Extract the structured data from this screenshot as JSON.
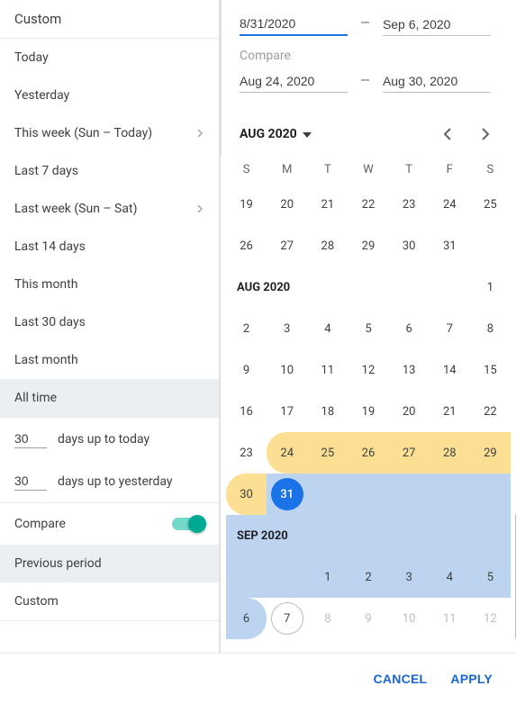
{
  "presets": {
    "custom": "Custom",
    "today": "Today",
    "yesterday": "Yesterday",
    "this_week": "This week (Sun – Today)",
    "last7": "Last 7 days",
    "last_week": "Last week (Sun – Sat)",
    "last14": "Last 14 days",
    "this_month": "This month",
    "last30": "Last 30 days",
    "last_month": "Last month",
    "all_time": "All time"
  },
  "days_up": {
    "today_value": "30",
    "today_label": "days up to today",
    "yesterday_value": "30",
    "yesterday_label": "days up to yesterday"
  },
  "compare_section": {
    "label": "Compare",
    "previous": "Previous period",
    "custom": "Custom"
  },
  "range": {
    "start": "8/31/2020",
    "dash": "—",
    "end": "Sep 6, 2020"
  },
  "compare_range": {
    "label": "Compare",
    "start": "Aug 24, 2020",
    "dash": "—",
    "end": "Aug 30, 2020"
  },
  "month_nav": {
    "label": "AUG 2020"
  },
  "dow": [
    "S",
    "M",
    "T",
    "W",
    "T",
    "F",
    "S"
  ],
  "cal": {
    "prev_rows": [
      [
        "19",
        "20",
        "21",
        "22",
        "23",
        "24",
        "25"
      ],
      [
        "26",
        "27",
        "28",
        "29",
        "30",
        "31",
        ""
      ]
    ],
    "aug_header": "AUG 2020",
    "aug_day1": "1",
    "aug_rows": [
      [
        "2",
        "3",
        "4",
        "5",
        "6",
        "7",
        "8"
      ],
      [
        "9",
        "10",
        "11",
        "12",
        "13",
        "14",
        "15"
      ],
      [
        "16",
        "17",
        "18",
        "19",
        "20",
        "21",
        "22"
      ]
    ],
    "aug_row_cmp": [
      "23",
      "24",
      "25",
      "26",
      "27",
      "28",
      "29"
    ],
    "aug_row_sel": [
      "30",
      "31",
      "",
      "",
      "",
      "",
      ""
    ],
    "sep_header": "SEP 2020",
    "sep_row1": [
      "",
      "",
      "1",
      "2",
      "3",
      "4",
      "5"
    ],
    "sep_row2": [
      "6",
      "7",
      "8",
      "9",
      "10",
      "11",
      "12"
    ]
  },
  "footer": {
    "cancel": "CANCEL",
    "apply": "APPLY"
  }
}
